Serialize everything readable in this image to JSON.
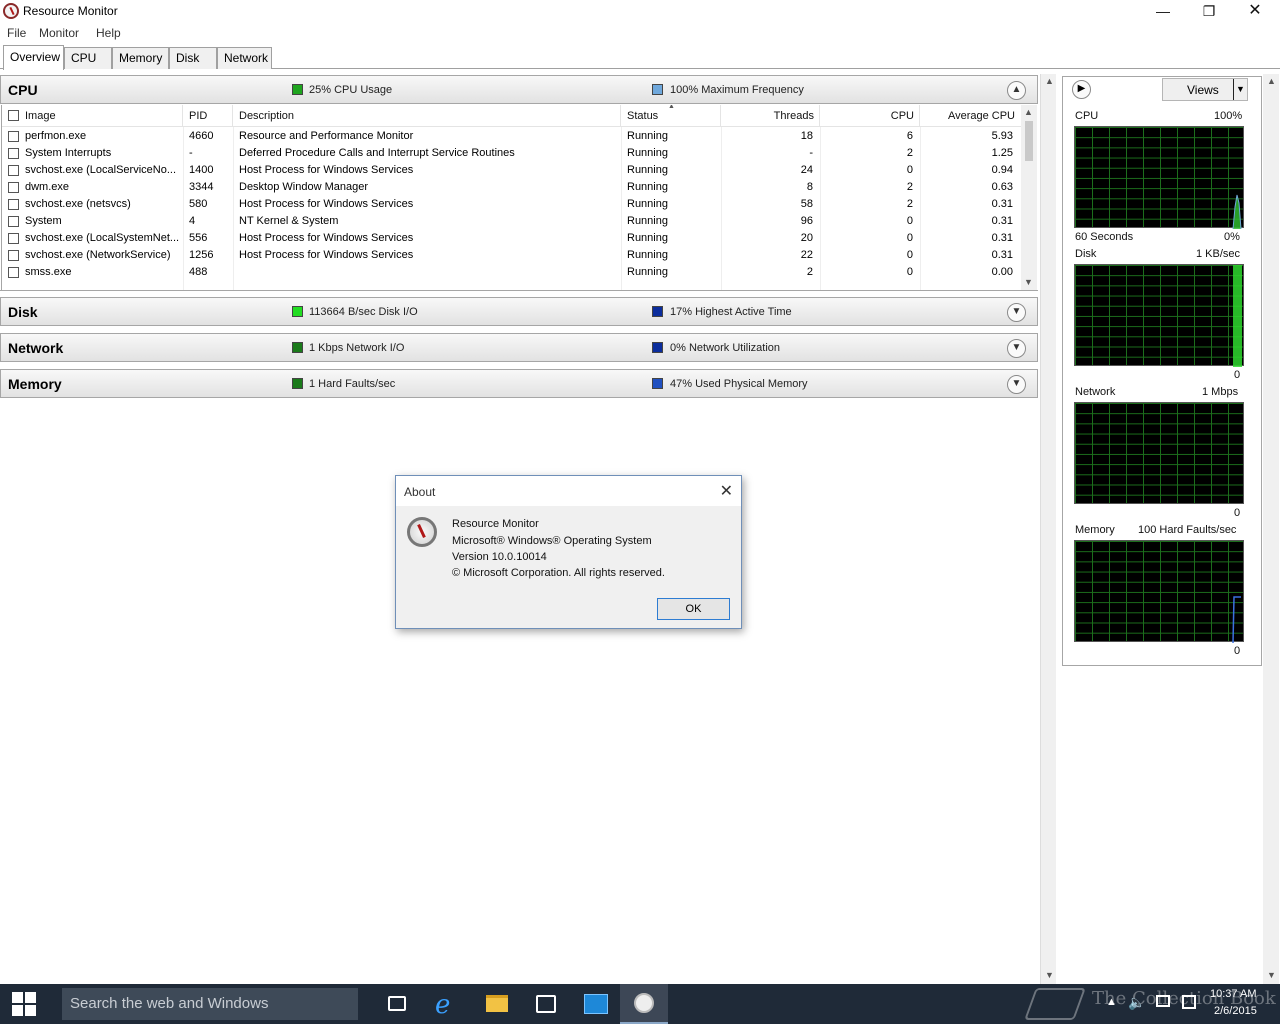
{
  "window": {
    "title": "Resource Monitor"
  },
  "menu": [
    "File",
    "Monitor",
    "Help"
  ],
  "tabs": [
    "Overview",
    "CPU",
    "Memory",
    "Disk",
    "Network"
  ],
  "panels": {
    "cpu": {
      "title": "CPU",
      "stat1": "25% CPU Usage",
      "stat2": "100% Maximum Frequency"
    },
    "disk": {
      "title": "Disk",
      "stat1": "113664 B/sec Disk I/O",
      "stat2": "17% Highest Active Time"
    },
    "network": {
      "title": "Network",
      "stat1": "1 Kbps Network I/O",
      "stat2": "0% Network Utilization"
    },
    "memory": {
      "title": "Memory",
      "stat1": "1 Hard Faults/sec",
      "stat2": "47% Used Physical Memory"
    }
  },
  "table": {
    "headers": [
      "Image",
      "PID",
      "Description",
      "Status",
      "Threads",
      "CPU",
      "Average CPU"
    ],
    "rows": [
      [
        "perfmon.exe",
        "4660",
        "Resource and Performance Monitor",
        "Running",
        "18",
        "6",
        "5.93"
      ],
      [
        "System Interrupts",
        "-",
        "Deferred Procedure Calls and Interrupt Service Routines",
        "Running",
        "-",
        "2",
        "1.25"
      ],
      [
        "svchost.exe (LocalServiceNo...",
        "1400",
        "Host Process for Windows Services",
        "Running",
        "24",
        "0",
        "0.94"
      ],
      [
        "dwm.exe",
        "3344",
        "Desktop Window Manager",
        "Running",
        "8",
        "2",
        "0.63"
      ],
      [
        "svchost.exe (netsvcs)",
        "580",
        "Host Process for Windows Services",
        "Running",
        "58",
        "2",
        "0.31"
      ],
      [
        "System",
        "4",
        "NT Kernel & System",
        "Running",
        "96",
        "0",
        "0.31"
      ],
      [
        "svchost.exe (LocalSystemNet...",
        "556",
        "Host Process for Windows Services",
        "Running",
        "20",
        "0",
        "0.31"
      ],
      [
        "svchost.exe (NetworkService)",
        "1256",
        "Host Process for Windows Services",
        "Running",
        "22",
        "0",
        "0.31"
      ],
      [
        "smss.exe",
        "488",
        "",
        "Running",
        "2",
        "0",
        "0.00"
      ]
    ]
  },
  "right": {
    "views_label": "Views",
    "cpu": {
      "name": "CPU",
      "max": "100%",
      "footer_left": "60 Seconds",
      "footer_right": "0%"
    },
    "disk": {
      "name": "Disk",
      "max": "1 KB/sec",
      "min": "0"
    },
    "network": {
      "name": "Network",
      "max": "1 Mbps",
      "min": "0"
    },
    "memory": {
      "name": "Memory",
      "max": "100 Hard Faults/sec",
      "min": "0"
    }
  },
  "about": {
    "title": "About",
    "line1": "Resource Monitor",
    "line2": "Microsoft® Windows® Operating System",
    "line3": "Version 10.0.10014",
    "line4": "© Microsoft Corporation. All rights reserved.",
    "ok": "OK"
  },
  "taskbar": {
    "search_placeholder": "Search the web and Windows",
    "watermark": "The Collection Book",
    "time": "10:37 AM",
    "date": "2/6/2015"
  },
  "colors": {
    "cpu_usage": "#1fa51f",
    "cpu_freq": "#6fa8dc",
    "disk_io": "#22dd22",
    "disk_active": "#0b2d9c",
    "net_io": "#1a7a1a",
    "net_util": "#0b2d9c",
    "mem_faults": "#1a7a1a",
    "mem_used": "#2050c0"
  }
}
